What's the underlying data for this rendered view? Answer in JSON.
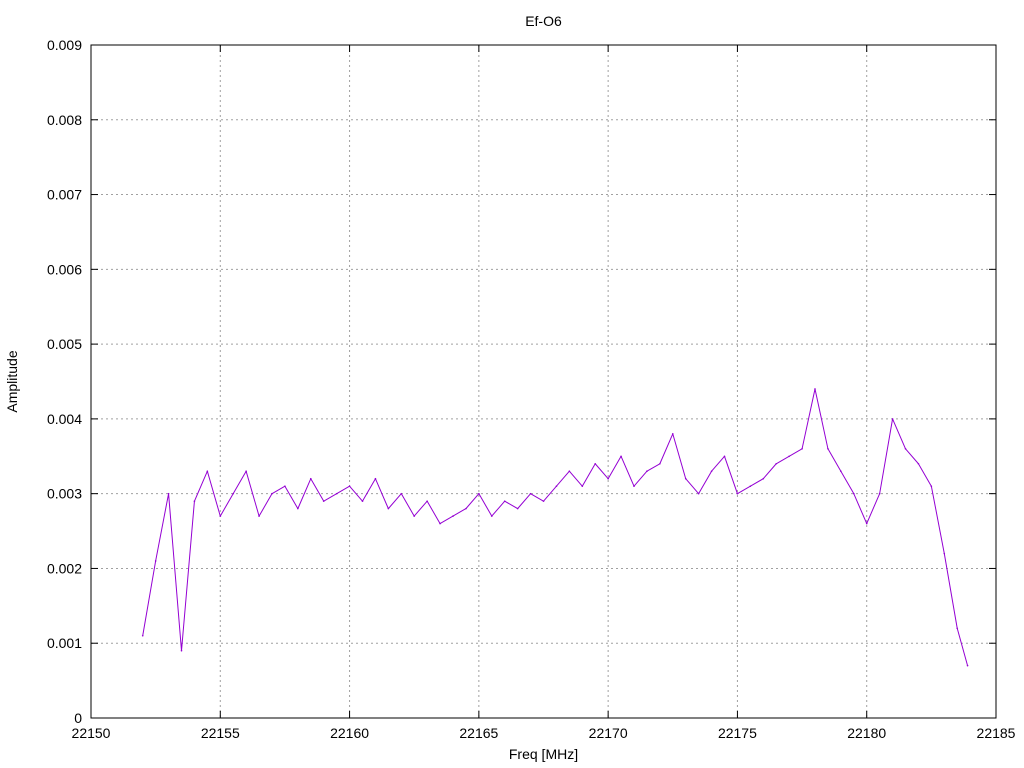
{
  "chart_data": {
    "type": "line",
    "title": "Ef-O6",
    "xlabel": "Freq [MHz]",
    "ylabel": "Amplitude",
    "xlim": [
      22150,
      22185
    ],
    "ylim": [
      0,
      0.009
    ],
    "x_ticks": [
      22150,
      22155,
      22160,
      22165,
      22170,
      22175,
      22180,
      22185
    ],
    "x_tick_labels": [
      "22150",
      "22155",
      "22160",
      "22165",
      "22170",
      "22175",
      "22180",
      "22185"
    ],
    "y_ticks": [
      0,
      0.001,
      0.002,
      0.003,
      0.004,
      0.005,
      0.006,
      0.007,
      0.008,
      0.009
    ],
    "y_tick_labels": [
      "0",
      "0.001",
      "0.002",
      "0.003",
      "0.004",
      "0.005",
      "0.006",
      "0.007",
      "0.008",
      "0.009"
    ],
    "grid": true,
    "legend": "none",
    "series_color": "#9400d3",
    "series": [
      {
        "x": [
          22152.0,
          22152.5,
          22153.0,
          22153.5,
          22154.0,
          22154.5,
          22155.0,
          22155.5,
          22156.0,
          22156.5,
          22157.0,
          22157.5,
          22158.0,
          22158.5,
          22159.0,
          22159.5,
          22160.0,
          22160.5,
          22161.0,
          22161.5,
          22162.0,
          22162.5,
          22163.0,
          22163.5,
          22164.0,
          22164.5,
          22165.0,
          22165.5,
          22166.0,
          22166.5,
          22167.0,
          22167.5,
          22168.0,
          22168.5,
          22169.0,
          22169.5,
          22170.0,
          22170.5,
          22171.0,
          22171.5,
          22172.0,
          22172.5,
          22173.0,
          22173.5,
          22174.0,
          22174.5,
          22175.0,
          22175.5,
          22176.0,
          22176.5,
          22177.0,
          22177.5,
          22178.0,
          22178.5,
          22179.0,
          22179.5,
          22180.0,
          22180.5,
          22181.0,
          22181.5,
          22182.0,
          22182.5,
          22183.0,
          22183.5,
          22183.9
        ],
        "values": [
          0.0011,
          0.0021,
          0.003,
          0.0009,
          0.0029,
          0.0033,
          0.0027,
          0.003,
          0.0033,
          0.0027,
          0.003,
          0.0031,
          0.0028,
          0.0032,
          0.0029,
          0.003,
          0.0031,
          0.0029,
          0.0032,
          0.0028,
          0.003,
          0.0027,
          0.0029,
          0.0026,
          0.0027,
          0.0028,
          0.003,
          0.0027,
          0.0029,
          0.0028,
          0.003,
          0.0029,
          0.0031,
          0.0033,
          0.0031,
          0.0034,
          0.0032,
          0.0035,
          0.0031,
          0.0033,
          0.0034,
          0.0038,
          0.0032,
          0.003,
          0.0033,
          0.0035,
          0.003,
          0.0031,
          0.0032,
          0.0034,
          0.0035,
          0.0036,
          0.0044,
          0.0036,
          0.0033,
          0.003,
          0.0026,
          0.003,
          0.004,
          0.0036,
          0.0034,
          0.0031,
          0.0022,
          0.0012,
          0.0007
        ]
      }
    ]
  }
}
